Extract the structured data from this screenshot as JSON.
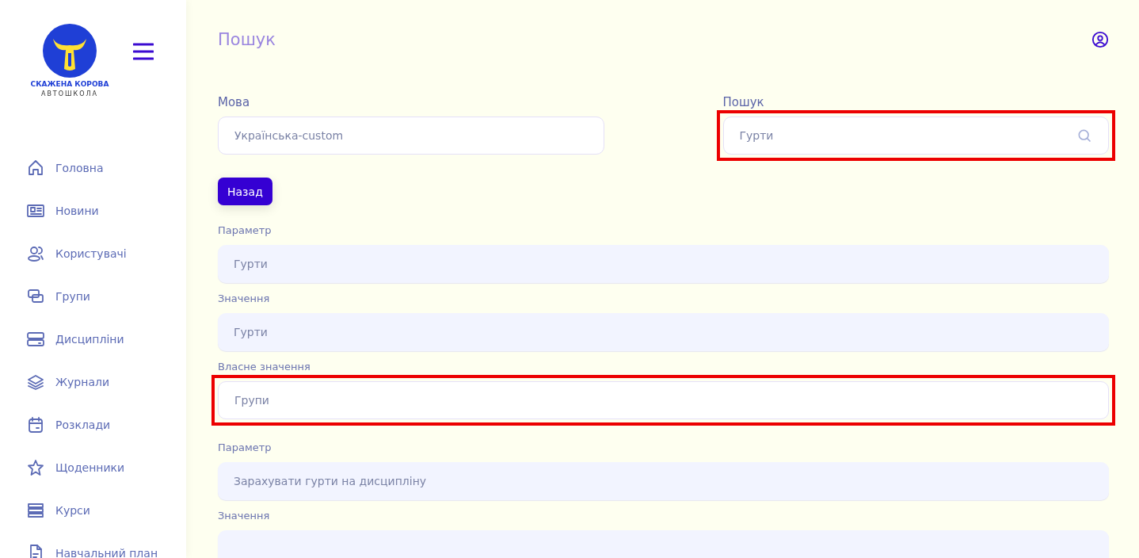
{
  "sidebar": {
    "logo": {
      "name": "СКАЖЕНА КОРОВА",
      "subtitle": "АВТОШКОЛА"
    },
    "items": [
      {
        "label": "Головна"
      },
      {
        "label": "Новини"
      },
      {
        "label": "Користувачі"
      },
      {
        "label": "Групи"
      },
      {
        "label": "Дисципліни"
      },
      {
        "label": "Журнали"
      },
      {
        "label": "Розклади"
      },
      {
        "label": "Щоденники"
      },
      {
        "label": "Курси"
      },
      {
        "label": "Навчальний план"
      }
    ]
  },
  "header": {
    "title": "Пошук"
  },
  "filters": [
    {
      "label": "Мова",
      "value": "Українська-custom",
      "kind": "select",
      "highlighted": false
    },
    {
      "label": "Пошук",
      "value": "Гурти",
      "kind": "search",
      "highlighted": true
    }
  ],
  "back_button": "Назад",
  "groups": [
    {
      "fields": [
        {
          "label": "Параметр",
          "value": "Гурти",
          "kind": "readonly",
          "highlighted": false
        },
        {
          "label": "Значення",
          "value": "Гурти",
          "kind": "readonly",
          "highlighted": false
        },
        {
          "label": "Власне значення",
          "value": "Групи",
          "kind": "editable",
          "highlighted": true
        }
      ]
    },
    {
      "fields": [
        {
          "label": "Параметр",
          "value": "Зарахувати гурти на дисципліну",
          "kind": "readonly",
          "highlighted": false
        },
        {
          "label": "Значення",
          "kind": "readonly",
          "highlighted": false
        }
      ]
    }
  ]
}
